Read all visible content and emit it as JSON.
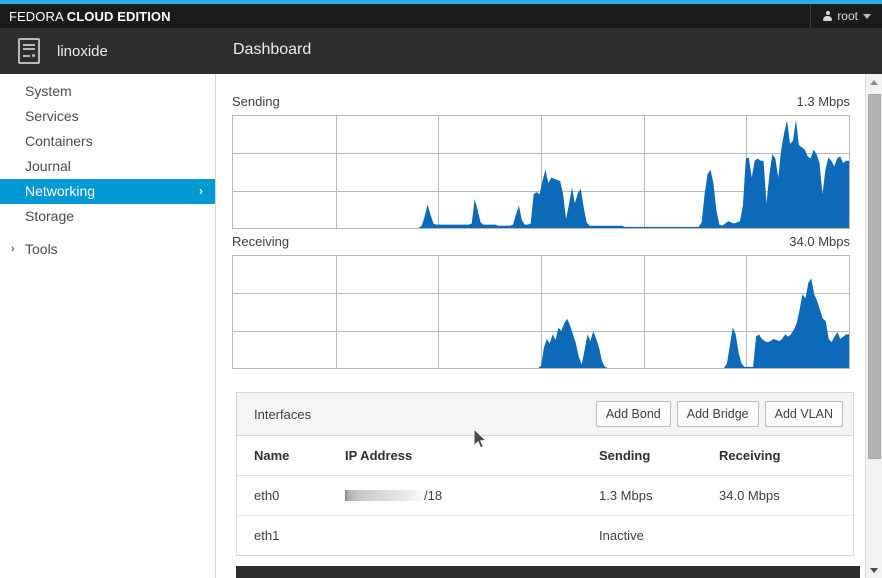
{
  "brand": {
    "prefix": "FEDORA ",
    "bold": "CLOUD EDITION",
    "accent_color": "#2bace2",
    "bar_color": "#1b1b1b"
  },
  "user_menu": {
    "label": "root",
    "icon": "user-icon",
    "caret": "chevron-down-icon"
  },
  "host": {
    "name": "linoxide",
    "logo_icon": "server-icon"
  },
  "header": {
    "title": "Dashboard"
  },
  "sidebar": {
    "accent_color": "#0099d3",
    "items": [
      {
        "label": "System",
        "active": false,
        "chevron": ""
      },
      {
        "label": "Services",
        "active": false,
        "chevron": ""
      },
      {
        "label": "Containers",
        "active": false,
        "chevron": ""
      },
      {
        "label": "Journal",
        "active": false,
        "chevron": ""
      },
      {
        "label": "Networking",
        "active": true,
        "chevron": "›"
      },
      {
        "label": "Storage",
        "active": false,
        "chevron": ""
      }
    ],
    "groups": [
      {
        "label": "Tools",
        "caret": "›"
      }
    ]
  },
  "graphs": [
    {
      "key": "sending",
      "label": "Sending",
      "value": "1.3 Mbps"
    },
    {
      "key": "receiving",
      "label": "Receiving",
      "value": "34.0 Mbps"
    }
  ],
  "chart_data": [
    {
      "type": "area",
      "title": "Sending",
      "ylabel": "1.3 Mbps",
      "xlabel": "",
      "grid": true,
      "grid_cols": 6,
      "grid_rows": 3,
      "ylim": [
        0,
        1.3
      ],
      "series_color": "#0d6ab8",
      "series": [
        {
          "name": "Sending",
          "values": [
            0,
            0,
            0,
            0,
            0,
            0,
            0,
            0,
            0,
            0,
            0,
            0,
            0,
            0,
            0,
            0,
            0,
            0,
            0,
            0,
            0,
            0,
            0,
            0,
            0,
            0,
            0,
            0,
            0,
            0,
            0,
            0,
            0,
            0,
            0,
            0,
            0,
            0,
            0,
            0,
            0,
            0,
            0,
            0,
            0,
            0,
            0,
            0,
            0,
            0,
            0,
            0,
            0,
            0,
            0,
            0,
            0,
            0,
            0,
            0,
            0,
            0,
            0,
            0,
            0.02,
            0.1,
            0.21,
            0.12,
            0.04,
            0.03,
            0.03,
            0.03,
            0.03,
            0.03,
            0.03,
            0.03,
            0.03,
            0.03,
            0.03,
            0.03,
            0.03,
            0.04,
            0.26,
            0.16,
            0.05,
            0.03,
            0.03,
            0.03,
            0.03,
            0.03,
            0.02,
            0.02,
            0.02,
            0.02,
            0.02,
            0.03,
            0.12,
            0.2,
            0.07,
            0.03,
            0.03,
            0.04,
            0.3,
            0.32,
            0.3,
            0.42,
            0.52,
            0.4,
            0.45,
            0.44,
            0.43,
            0.42,
            0.3,
            0.08,
            0.21,
            0.36,
            0.22,
            0.31,
            0.35,
            0.18,
            0.05,
            0.02,
            0.02,
            0.02,
            0.02,
            0.02,
            0.02,
            0.02,
            0.02,
            0.02,
            0.02,
            0.02,
            0.02,
            0.01,
            0.01,
            0.01,
            0.01,
            0.01,
            0.01,
            0.01,
            0.01,
            0.01,
            0.01,
            0.01,
            0.01,
            0.01,
            0.01,
            0.01,
            0.01,
            0.01,
            0.01,
            0.01,
            0.01,
            0.01,
            0.01,
            0.01,
            0.01,
            0.01,
            0.01,
            0.05,
            0.3,
            0.48,
            0.52,
            0.4,
            0.16,
            0.03,
            0.02,
            0.04,
            0.06,
            0.05,
            0.04,
            0.05,
            0.06,
            0.2,
            0.62,
            0.63,
            0.45,
            0.6,
            0.62,
            0.6,
            0.6,
            0.22,
            0.48,
            0.66,
            0.62,
            0.45,
            0.7,
            0.85,
            0.96,
            0.75,
            0.78,
            0.97,
            0.74,
            0.72,
            0.7,
            0.64,
            0.62,
            0.7,
            0.66,
            0.58,
            0.3,
            0.52,
            0.63,
            0.6,
            0.55,
            0.62,
            0.64,
            0.58,
            0.6,
            0.6
          ]
        }
      ]
    },
    {
      "type": "area",
      "title": "Receiving",
      "ylabel": "34.0 Mbps",
      "xlabel": "",
      "grid": true,
      "grid_cols": 6,
      "grid_rows": 3,
      "ylim": [
        0,
        34.0
      ],
      "series_color": "#0d6ab8",
      "series": [
        {
          "name": "Receiving",
          "values": [
            0,
            0,
            0,
            0,
            0,
            0,
            0,
            0,
            0,
            0,
            0,
            0,
            0,
            0,
            0,
            0,
            0,
            0,
            0,
            0,
            0,
            0,
            0,
            0,
            0,
            0,
            0,
            0,
            0,
            0,
            0,
            0,
            0,
            0,
            0,
            0,
            0,
            0,
            0,
            0,
            0,
            0,
            0,
            0,
            0,
            0,
            0,
            0,
            0,
            0,
            0,
            0,
            0,
            0,
            0,
            0,
            0,
            0,
            0,
            0,
            0,
            0,
            0,
            0,
            0,
            0,
            0,
            0,
            0,
            0,
            0,
            0,
            0,
            0,
            0,
            0,
            0,
            0,
            0,
            0,
            0,
            0,
            0,
            0,
            0,
            0,
            0,
            0,
            0,
            0,
            0,
            0,
            0,
            0,
            0,
            0,
            0,
            0,
            0,
            0,
            0,
            0,
            0,
            0,
            0,
            0,
            0.02,
            0.18,
            0.26,
            0.22,
            0.3,
            0.25,
            0.36,
            0.33,
            0.4,
            0.44,
            0.38,
            0.3,
            0.22,
            0.1,
            0.03,
            0.16,
            0.3,
            0.24,
            0.33,
            0.26,
            0.18,
            0.06,
            0.01,
            0,
            0,
            0,
            0,
            0,
            0,
            0,
            0,
            0,
            0,
            0,
            0,
            0,
            0,
            0,
            0,
            0,
            0,
            0,
            0,
            0,
            0,
            0,
            0,
            0,
            0,
            0,
            0,
            0,
            0,
            0,
            0,
            0,
            0,
            0,
            0,
            0,
            0,
            0,
            0,
            0,
            0.04,
            0.2,
            0.36,
            0.3,
            0.14,
            0.04,
            0.01,
            0.01,
            0.01,
            0.01,
            0.28,
            0.3,
            0.26,
            0.24,
            0.23,
            0.24,
            0.26,
            0.25,
            0.24,
            0.26,
            0.3,
            0.28,
            0.3,
            0.34,
            0.4,
            0.52,
            0.66,
            0.62,
            0.76,
            0.8,
            0.66,
            0.6,
            0.52,
            0.44,
            0.42,
            0.26,
            0.23,
            0.28,
            0.32,
            0.26,
            0.28,
            0.3,
            0.3
          ]
        }
      ]
    }
  ],
  "interfaces_panel": {
    "title": "Interfaces",
    "buttons": [
      {
        "label": "Add Bond"
      },
      {
        "label": "Add Bridge"
      },
      {
        "label": "Add VLAN"
      }
    ],
    "columns": [
      "Name",
      "IP Address",
      "Sending",
      "Receiving"
    ],
    "rows": [
      {
        "name": "eth0",
        "ip_redacted": true,
        "ip_suffix": "/18",
        "sending": "1.3 Mbps",
        "receiving": "34.0 Mbps"
      },
      {
        "name": "eth1",
        "ip_redacted": false,
        "ip_suffix": "",
        "sending": "Inactive",
        "receiving": ""
      }
    ]
  },
  "scrollbar": {
    "up_arrow": "scroll-up-icon",
    "down_arrow": "scroll-down-icon"
  }
}
